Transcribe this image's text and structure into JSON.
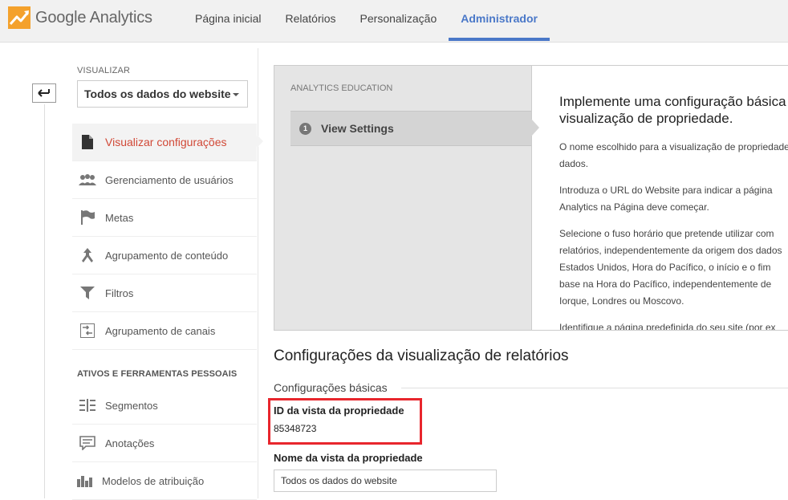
{
  "brand": {
    "name_google": "Google",
    "name_analytics": "Analytics"
  },
  "nav": {
    "tabs": [
      {
        "label": "Página inicial"
      },
      {
        "label": "Relatórios"
      },
      {
        "label": "Personalização"
      },
      {
        "label": "Administrador",
        "active": true
      }
    ]
  },
  "sidebar": {
    "view_label": "VISUALIZAR",
    "view_selected": "Todos os dados do website",
    "items": [
      {
        "label": "Visualizar configurações",
        "icon": "document-icon",
        "active": true
      },
      {
        "label": "Gerenciamento de usuários",
        "icon": "users-icon"
      },
      {
        "label": "Metas",
        "icon": "flag-icon"
      },
      {
        "label": "Agrupamento de conteúdo",
        "icon": "merge-icon"
      },
      {
        "label": "Filtros",
        "icon": "filter-icon"
      },
      {
        "label": "Agrupamento de canais",
        "icon": "channel-icon"
      }
    ],
    "section_personal": "ATIVOS E FERRAMENTAS PESSOAIS",
    "personal_items": [
      {
        "label": "Segmentos",
        "icon": "segments-icon"
      },
      {
        "label": "Anotações",
        "icon": "annotation-icon"
      },
      {
        "label": "Modelos de atribuição",
        "icon": "bars-icon"
      }
    ]
  },
  "education": {
    "label": "ANALYTICS EDUCATION",
    "step_number": "1",
    "step_label": "View Settings",
    "heading_line1": "Implemente uma configuração básica",
    "heading_line2": "visualização de propriedade.",
    "paragraphs": [
      [
        "O nome escolhido para a visualização de propriedade",
        "dados."
      ],
      [
        "Introduza o URL do Website para indicar a página",
        "Analytics na Página deve começar."
      ],
      [
        "Selecione o fuso horário que pretende utilizar com",
        "relatórios, independentemente da origem dos dados",
        "Estados Unidos, Hora do Pacífico, o início e o fim",
        "base na Hora do Pacífico, independentemente de",
        "Iorque, Londres ou Moscovo."
      ],
      [
        "Identifique a página predefinida do seu site (por ex"
      ]
    ]
  },
  "main": {
    "title": "Configurações da visualização de relatórios",
    "subtitle": "Configurações básicas",
    "id_label": "ID da vista da propriedade",
    "id_value": "85348723",
    "name_label": "Nome da vista da propriedade",
    "name_value": "Todos os dados do website"
  },
  "colors": {
    "accent": "#4a78c8",
    "active_item": "#d14836",
    "highlight_box": "#e8262d"
  }
}
